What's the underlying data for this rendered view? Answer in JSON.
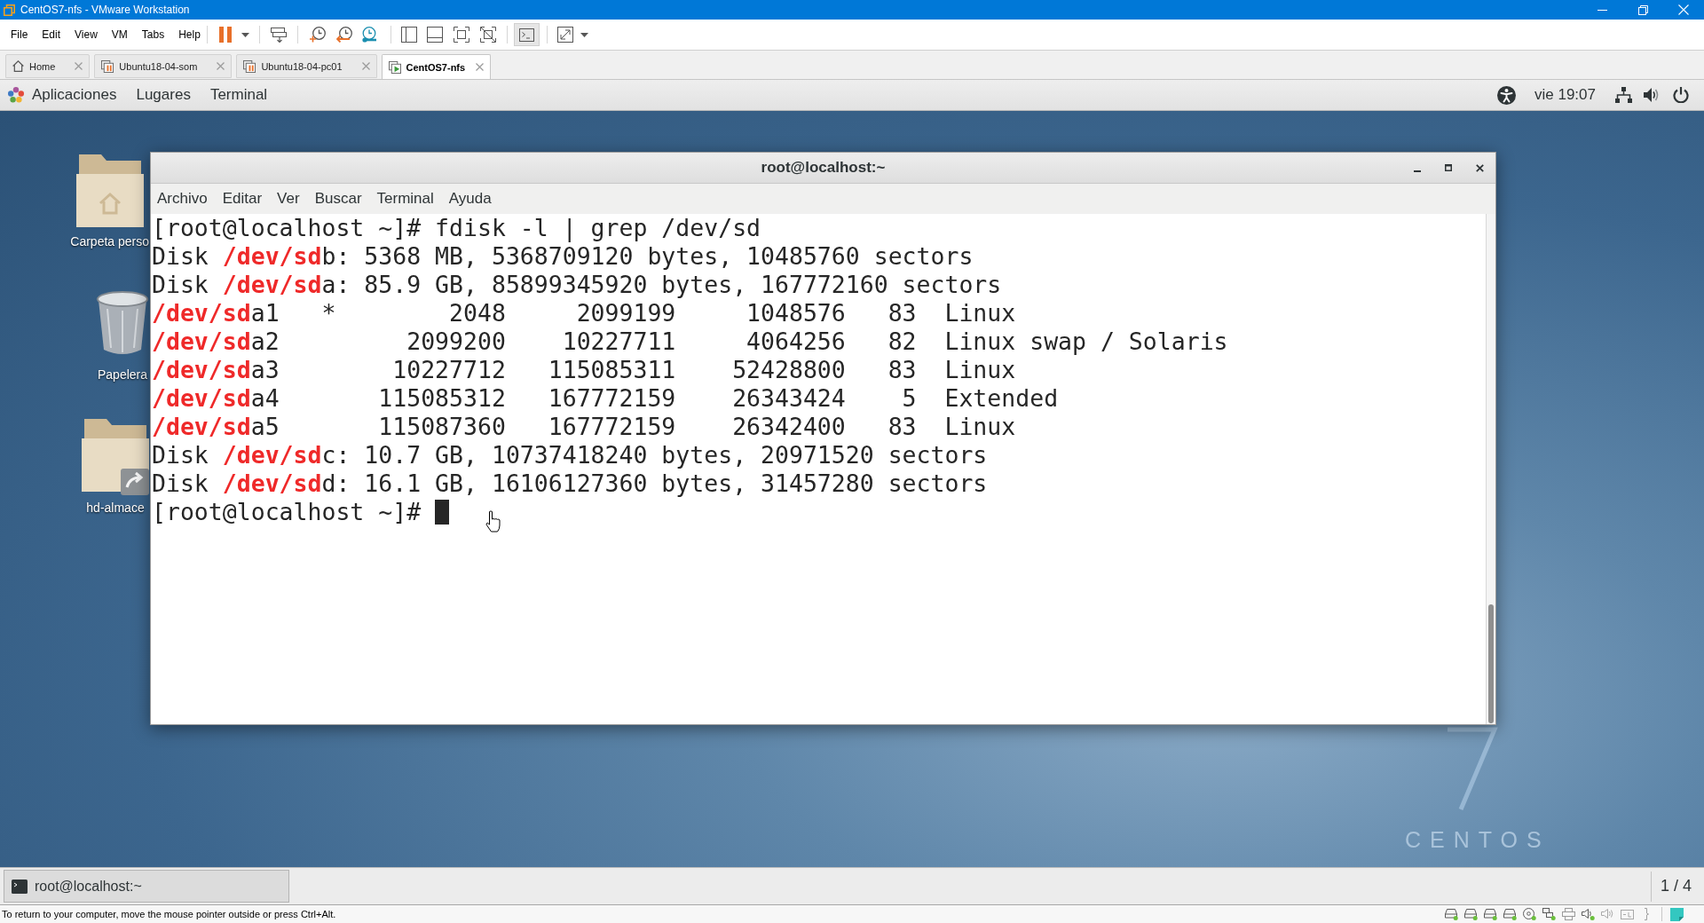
{
  "vmware": {
    "title": "CentOS7-nfs - VMware Workstation",
    "menu": [
      "File",
      "Edit",
      "View",
      "VM",
      "Tabs",
      "Help"
    ],
    "tabs": [
      {
        "label": "Home",
        "kind": "home",
        "selected": false
      },
      {
        "label": "Ubuntu18-04-som",
        "kind": "vm_paused",
        "selected": false
      },
      {
        "label": "Ubuntu18-04-pc01",
        "kind": "vm_paused",
        "selected": false
      },
      {
        "label": "CentOS7-nfs",
        "kind": "vm_running",
        "selected": true
      }
    ],
    "status_message": "To return to your computer, move the mouse pointer outside or press Ctrl+Alt."
  },
  "top_bar": {
    "menus": [
      "Aplicaciones",
      "Lugares",
      "Terminal"
    ],
    "clock": "vie 19:07"
  },
  "desktop": {
    "icons": [
      {
        "label": "Carpeta perso",
        "kind": "home_folder"
      },
      {
        "label": "Papelera",
        "kind": "trash"
      },
      {
        "label": "hd-almace",
        "kind": "link_folder"
      }
    ],
    "wallpaper_text": "CENTOS"
  },
  "terminal": {
    "title": "root@localhost:~",
    "menu": [
      "Archivo",
      "Editar",
      "Ver",
      "Buscar",
      "Terminal",
      "Ayuda"
    ],
    "lines": [
      {
        "segments": [
          {
            "text": "[root@localhost ~]# fdisk -l | grep /dev/sd",
            "match": false
          }
        ]
      },
      {
        "segments": [
          {
            "text": "Disk ",
            "match": false
          },
          {
            "text": "/dev/sd",
            "match": true
          },
          {
            "text": "b: 5368 MB, 5368709120 bytes, 10485760 sectors",
            "match": false
          }
        ]
      },
      {
        "segments": [
          {
            "text": "Disk ",
            "match": false
          },
          {
            "text": "/dev/sd",
            "match": true
          },
          {
            "text": "a: 85.9 GB, 85899345920 bytes, 167772160 sectors",
            "match": false
          }
        ]
      },
      {
        "segments": [
          {
            "text": "/dev/sd",
            "match": true
          },
          {
            "text": "a1   *        2048     2099199     1048576   83  Linux",
            "match": false
          }
        ]
      },
      {
        "segments": [
          {
            "text": "/dev/sd",
            "match": true
          },
          {
            "text": "a2         2099200    10227711     4064256   82  Linux swap / Solaris",
            "match": false
          }
        ]
      },
      {
        "segments": [
          {
            "text": "/dev/sd",
            "match": true
          },
          {
            "text": "a3        10227712   115085311    52428800   83  Linux",
            "match": false
          }
        ]
      },
      {
        "segments": [
          {
            "text": "/dev/sd",
            "match": true
          },
          {
            "text": "a4       115085312   167772159    26343424    5  Extended",
            "match": false
          }
        ]
      },
      {
        "segments": [
          {
            "text": "/dev/sd",
            "match": true
          },
          {
            "text": "a5       115087360   167772159    26342400   83  Linux",
            "match": false
          }
        ]
      },
      {
        "segments": [
          {
            "text": "Disk ",
            "match": false
          },
          {
            "text": "/dev/sd",
            "match": true
          },
          {
            "text": "c: 10.7 GB, 10737418240 bytes, 20971520 sectors",
            "match": false
          }
        ]
      },
      {
        "segments": [
          {
            "text": "Disk ",
            "match": false
          },
          {
            "text": "/dev/sd",
            "match": true
          },
          {
            "text": "d: 16.1 GB, 16106127360 bytes, 31457280 sectors",
            "match": false
          }
        ]
      },
      {
        "segments": [
          {
            "text": "[root@localhost ~]#",
            "match": false
          }
        ]
      }
    ],
    "cursor": true
  },
  "taskbar": {
    "window_button": "root@localhost:~",
    "workspace": "1 / 4"
  }
}
